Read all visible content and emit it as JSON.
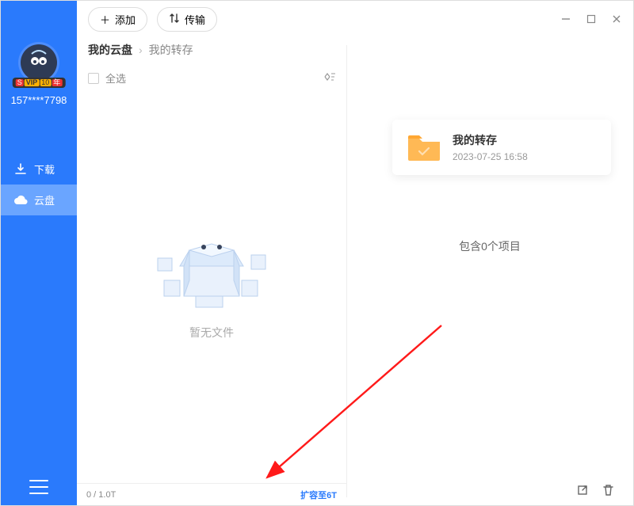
{
  "sidebar": {
    "vip_text": "VIP",
    "vip_num": "10",
    "vip_suffix": "年",
    "phone": "157****7798",
    "nav": [
      {
        "label": "下载"
      },
      {
        "label": "云盘"
      }
    ]
  },
  "titlebar": {
    "add": "添加",
    "transfer": "传输"
  },
  "breadcrumb": {
    "root": "我的云盘",
    "current": "我的转存"
  },
  "select_row": {
    "label": "全选"
  },
  "empty": {
    "text": "暂无文件"
  },
  "storage": {
    "usage": "0 / 1.0T",
    "expand": "扩容至6T"
  },
  "folder": {
    "name": "我的转存",
    "date": "2023-07-25 16:58",
    "count": "包含0个项目"
  }
}
